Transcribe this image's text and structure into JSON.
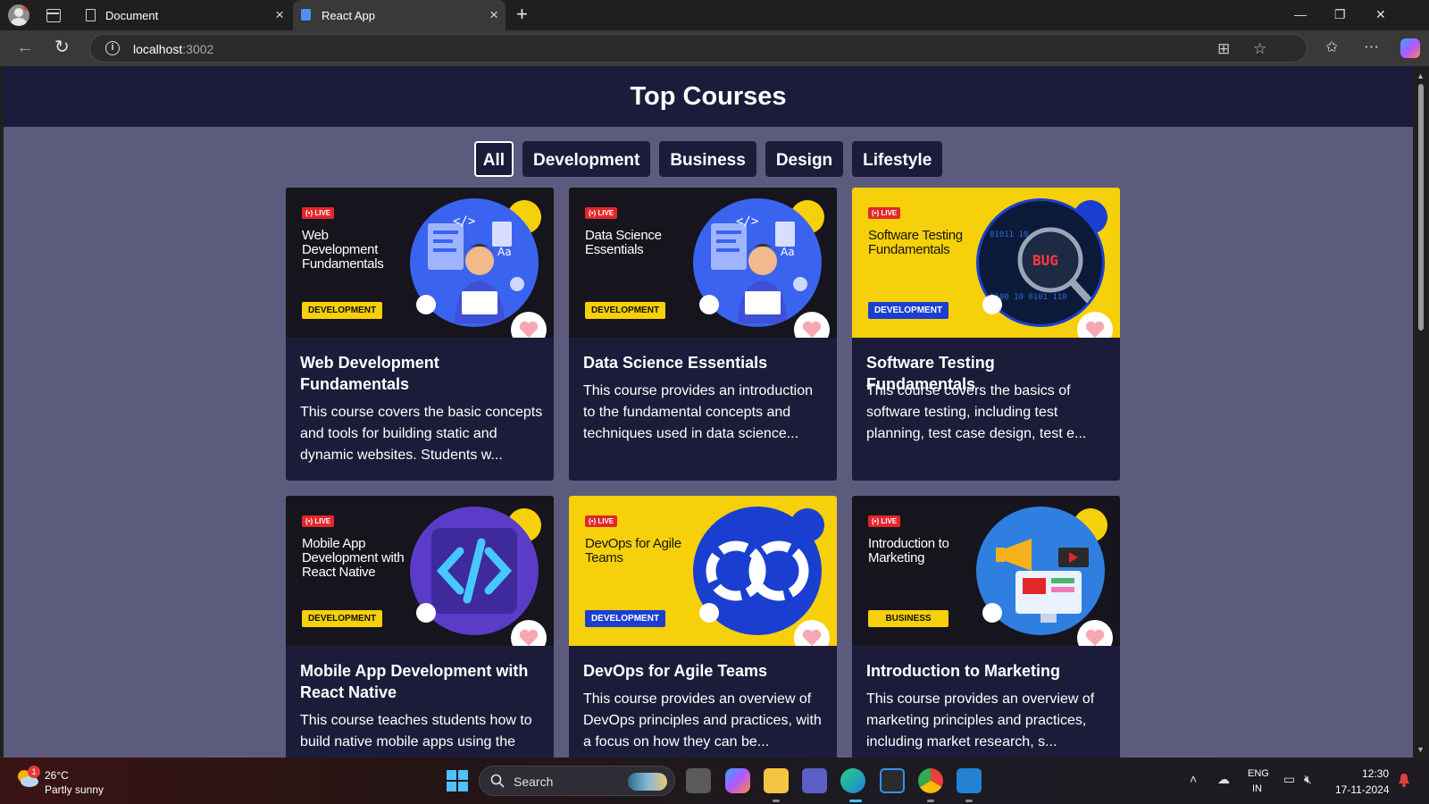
{
  "browser": {
    "tabs": [
      {
        "title": "Document",
        "active": false
      },
      {
        "title": "React App",
        "active": true
      }
    ],
    "new_tab_label": "+",
    "window_controls": {
      "minimize": "—",
      "restore": "❐",
      "close": "✕"
    },
    "url_host": "localhost",
    "url_port": ":3002"
  },
  "page": {
    "title": "Top Courses",
    "filters": [
      {
        "label": "All",
        "active": true
      },
      {
        "label": "Development",
        "active": false
      },
      {
        "label": "Business",
        "active": false
      },
      {
        "label": "Design",
        "active": false
      },
      {
        "label": "Lifestyle",
        "active": false
      }
    ],
    "courses": [
      {
        "thumb_live": "LIVE",
        "thumb_title": "Web Development Fundamentals",
        "thumb_tag": "DEVELOPMENT",
        "thumb_style": "dark",
        "title": "Web Development Fundamentals",
        "description": "This course covers the basic concepts and tools for building static and dynamic websites. Students w..."
      },
      {
        "thumb_live": "LIVE",
        "thumb_title": "Data Science Essentials",
        "thumb_tag": "DEVELOPMENT",
        "thumb_style": "dark",
        "title": "Data Science Essentials",
        "description": "This course provides an introduction to the fundamental concepts and techniques used in data science..."
      },
      {
        "thumb_live": "LIVE",
        "thumb_title": "Software Testing Fundamentals",
        "thumb_tag": "DEVELOPMENT",
        "thumb_style": "yellow",
        "title": "Software Testing Fundamentals",
        "description": "This course covers the basics of software testing, including test planning, test case design, test e..."
      },
      {
        "thumb_live": "LIVE",
        "thumb_title": "Mobile App Development with React Native",
        "thumb_tag": "DEVELOPMENT",
        "thumb_style": "dark",
        "title": "Mobile App Development with React Native",
        "description": "This course teaches students how to build native mobile apps using the"
      },
      {
        "thumb_live": "LIVE",
        "thumb_title": "DevOps for Agile Teams",
        "thumb_tag": "DEVELOPMENT",
        "thumb_style": "yellow",
        "title": "DevOps for Agile Teams",
        "description": "This course provides an overview of DevOps principles and practices, with a focus on how they can be..."
      },
      {
        "thumb_live": "LIVE",
        "thumb_title": "Introduction to Marketing",
        "thumb_tag": "BUSINESS",
        "thumb_style": "dark",
        "title": "Introduction to Marketing",
        "description": "This course provides an overview of marketing principles and practices, including market research, s..."
      }
    ],
    "bug_text": "BUG"
  },
  "taskbar": {
    "weather_temp": "26°C",
    "weather_condition": "Partly sunny",
    "weather_badge": "1",
    "search_placeholder": "Search",
    "language": "ENG",
    "region": "IN",
    "time": "12:30",
    "date": "17-11-2024"
  },
  "colors": {
    "page_bg": "#5c5b7d",
    "header_bg": "#1c1c3a",
    "card_bg": "#1c1c3a",
    "live_red": "#e4262b",
    "tag_yellow": "#f6d00a",
    "tag_blue": "#1a3fd0",
    "heart_pink": "#f7a7b4"
  }
}
